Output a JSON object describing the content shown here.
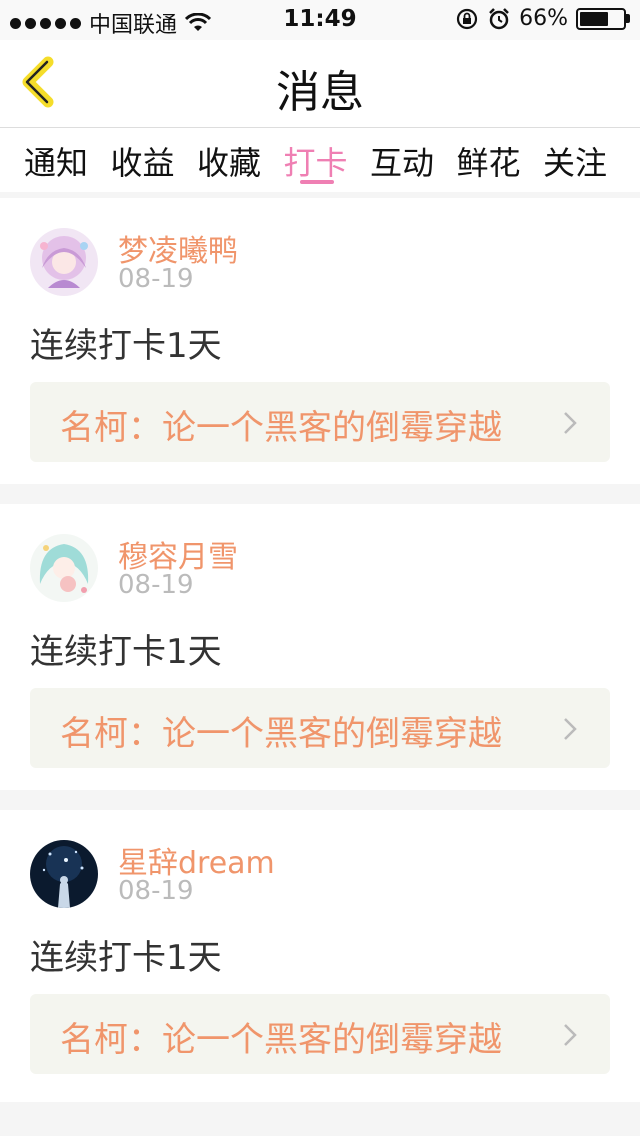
{
  "status_bar": {
    "carrier": "中国联通",
    "time": "11:49",
    "battery_percent": "66%",
    "battery_level": 0.66,
    "icons": [
      "signal-dots-icon",
      "wifi-icon",
      "rotation-lock-icon",
      "alarm-icon",
      "battery-icon"
    ]
  },
  "navbar": {
    "title": "消息",
    "back_icon": "chevron-left-icon",
    "accent_color": "#f5dd2a"
  },
  "tabs": [
    {
      "label": "通知",
      "active": false
    },
    {
      "label": "收益",
      "active": false
    },
    {
      "label": "收藏",
      "active": false
    },
    {
      "label": "打卡",
      "active": true
    },
    {
      "label": "互动",
      "active": false
    },
    {
      "label": "鲜花",
      "active": false
    },
    {
      "label": "关注",
      "active": false
    }
  ],
  "colors": {
    "active_tab": "#ef7fb3",
    "username": "#f0956b",
    "book_link": "#f0956b",
    "date": "#bbbbbb",
    "book_bg": "#f4f5ef"
  },
  "messages": [
    {
      "username": "梦凌曦鸭",
      "date": "08-19",
      "text": "连续打卡1天",
      "book": "名柯：论一个黑客的倒霉穿越",
      "avatar": "anime-girl-purple-avatar"
    },
    {
      "username": "穆容月雪",
      "date": "08-19",
      "text": "连续打卡1天",
      "book": "名柯：论一个黑客的倒霉穿越",
      "avatar": "anime-girl-teal-avatar"
    },
    {
      "username": "星辞dream",
      "date": "08-19",
      "text": "连续打卡1天",
      "book": "名柯：论一个黑客的倒霉穿越",
      "avatar": "starry-night-avatar"
    }
  ]
}
